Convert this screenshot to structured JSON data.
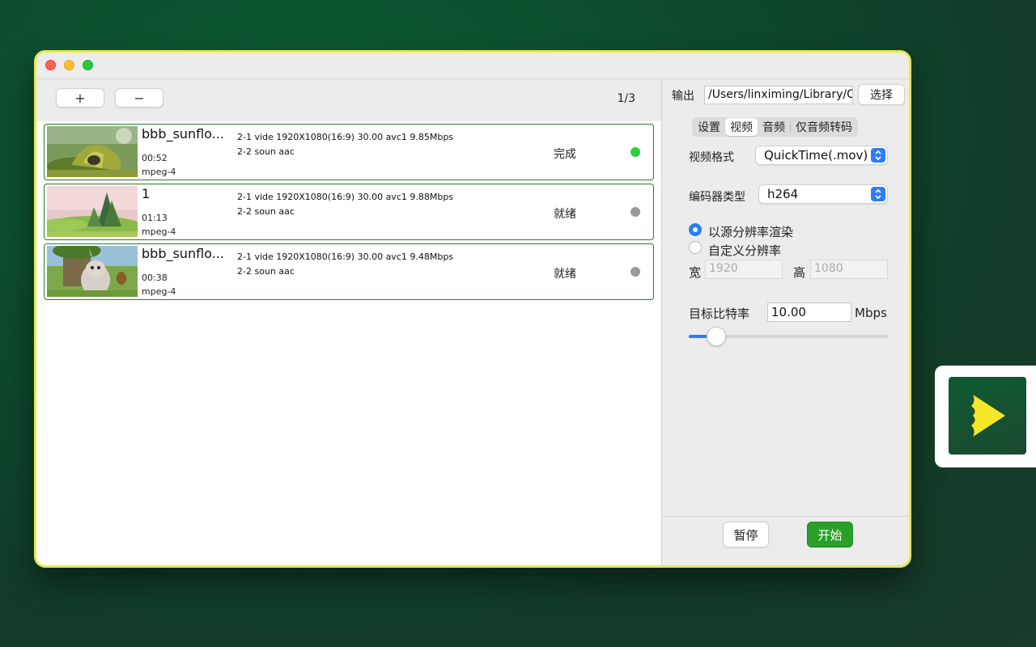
{
  "toolbar": {
    "add_label": "+",
    "remove_label": "−",
    "counter": "1/3"
  },
  "files": [
    {
      "name": "bbb_sunflo...",
      "duration": "00:52",
      "format": "mpeg-4",
      "stream1": "2-1 vide 1920X1080(16:9) 30.00 avc1 9.85Mbps",
      "stream2": "2-2 soun aac",
      "status": "完成",
      "dot_color": "#2ecc40"
    },
    {
      "name": "1",
      "duration": "01:13",
      "format": "mpeg-4",
      "stream1": "2-1 vide 1920X1080(16:9) 30.00 avc1 9.88Mbps",
      "stream2": "2-2 soun aac",
      "status": "就绪",
      "dot_color": "#999999"
    },
    {
      "name": "bbb_sunflo...",
      "duration": "00:38",
      "format": "mpeg-4",
      "stream1": "2-1 vide 1920X1080(16:9) 30.00 avc1 9.48Mbps",
      "stream2": "2-2 soun aac",
      "status": "就绪",
      "dot_color": "#999999"
    }
  ],
  "output": {
    "label": "输出",
    "path": "/Users/linximing/Library/C",
    "choose_label": "选择"
  },
  "tabs": [
    {
      "label": "设置",
      "active": false
    },
    {
      "label": "视频",
      "active": true
    },
    {
      "label": "音频",
      "active": false
    },
    {
      "label": "仅音频转码",
      "active": false
    }
  ],
  "video": {
    "format_label": "视频格式",
    "format_value": "QuickTime(.mov)",
    "codec_label": "编码器类型",
    "codec_value": "h264",
    "res_source_label": "以源分辨率渲染",
    "res_custom_label": "自定义分辨率",
    "width_label": "宽",
    "width_value": "1920",
    "height_label": "高",
    "height_value": "1080",
    "bitrate_label": "目标比特率",
    "bitrate_value": "10.00",
    "bitrate_unit": "Mbps",
    "bitrate_slider_fraction": 0.14
  },
  "actions": {
    "pause_label": "暂停",
    "start_label": "开始"
  },
  "colors": {
    "accent": "#2f7df6",
    "row_border": "#2d7a2d",
    "start": "#2aa02a",
    "window_border": "#e8e84a"
  },
  "icons": {
    "app": "play-icon"
  }
}
